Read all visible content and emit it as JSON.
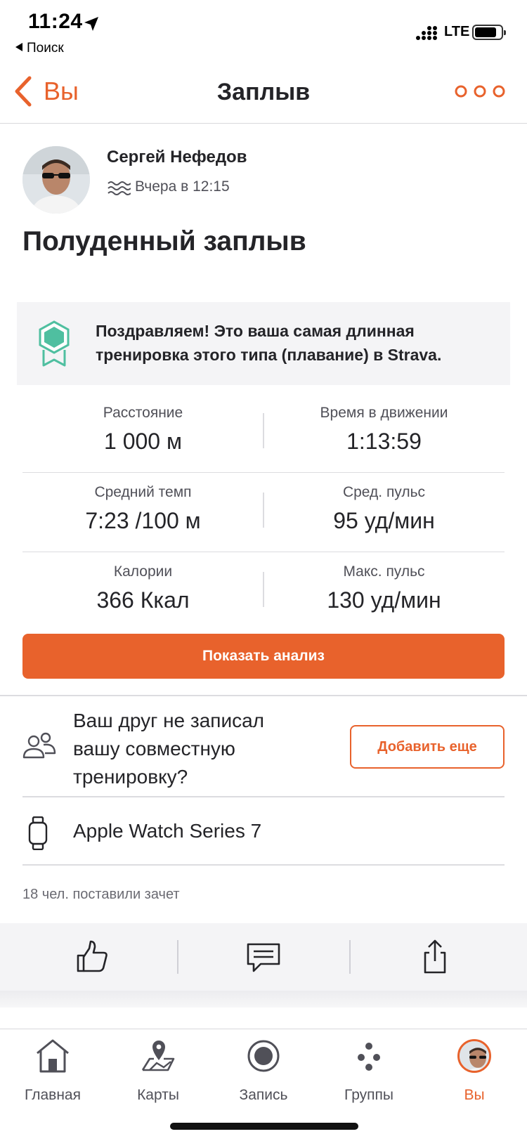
{
  "status_bar": {
    "time": "11:24",
    "back_app": "Поиск",
    "network": "LTE"
  },
  "nav": {
    "back_label": "Вы",
    "title": "Заплыв"
  },
  "athlete": {
    "name": "Сергей Нефедов",
    "activity_time": "Вчера в 12:15",
    "sport_icon": "swim-icon"
  },
  "activity": {
    "title": "Полуденный заплыв"
  },
  "achievement": {
    "icon": "badge-icon",
    "text": "Поздравляем! Это ваша самая длинная тренировка этого типа (плавание) в Strava.",
    "color": "#4fbfa0"
  },
  "stats": [
    {
      "left": {
        "label": "Расстояние",
        "value": "1 000 м"
      },
      "right": {
        "label": "Время в движении",
        "value": "1:13:59"
      }
    },
    {
      "left": {
        "label": "Средний темп",
        "value": "7:23 /100 м"
      },
      "right": {
        "label": "Сред. пульс",
        "value": "95 уд/мин"
      }
    },
    {
      "left": {
        "label": "Калории",
        "value": "366 Ккал"
      },
      "right": {
        "label": "Макс. пульс",
        "value": "130 уд/мин"
      }
    }
  ],
  "analyze_button": "Показать анализ",
  "friend_prompt": {
    "text": "Ваш друг не записал вашу совместную тренировку?",
    "button": "Добавить еще"
  },
  "device": {
    "name": "Apple Watch Series 7"
  },
  "kudos": {
    "text": "18 чел. поставили зачет"
  },
  "actions": [
    {
      "icon": "thumbs-up-icon"
    },
    {
      "icon": "comment-icon"
    },
    {
      "icon": "share-icon"
    }
  ],
  "tabs": [
    {
      "label": "Главная",
      "icon": "home-icon",
      "active": false
    },
    {
      "label": "Карты",
      "icon": "map-icon",
      "active": false
    },
    {
      "label": "Запись",
      "icon": "record-icon",
      "active": false
    },
    {
      "label": "Группы",
      "icon": "groups-icon",
      "active": false
    },
    {
      "label": "Вы",
      "icon": "avatar",
      "active": true
    }
  ],
  "colors": {
    "accent": "#e8622c",
    "text": "#242428",
    "muted": "#505058",
    "banner_bg": "#f4f4f6"
  }
}
